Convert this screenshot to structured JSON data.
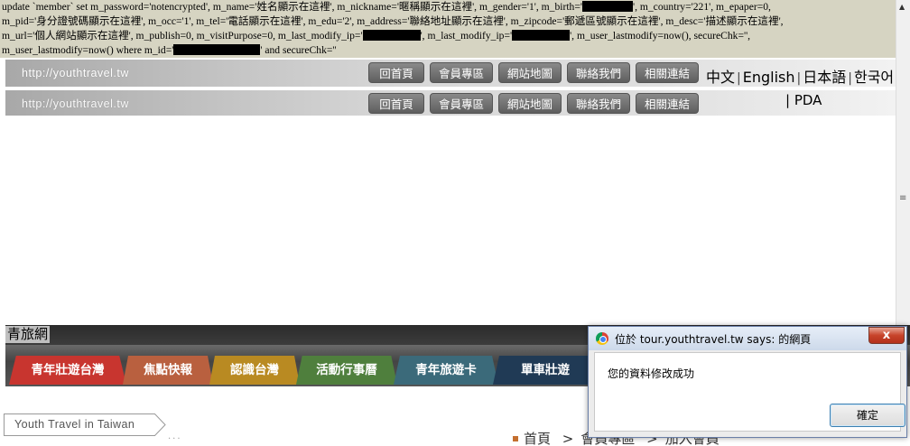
{
  "sql": {
    "line1_a": "update `member` set m_password='notencrypted', m_name='姓名顯示在這裡', m_nickname='暱稱顯示在這裡', m_gender='1', m_birth='",
    "line1_b": "', m_country='221', m_epaper=0,",
    "line2": "m_pid='身分證號碼顯示在這裡', m_occ='1', m_tel='電話顯示在這裡', m_edu='2', m_address='聯絡地址顯示在這裡', m_zipcode='郵遞區號顯示在這裡', m_desc='描述顯示在這裡',",
    "line3_a": "m_url='個人網站顯示在這裡', m_publish=0, m_visitPurpose=0, m_last_modify_ip='",
    "line3_b": "', m_last_modify_ip='",
    "line3_c": "', m_user_lastmodify=now(), secureChk='',",
    "line4_a": "m_user_lastmodify=now() where m_id='",
    "line4_b": "' and secureChk=''"
  },
  "header": {
    "site_url": "http://youthtravel.tw",
    "nav": [
      "回首頁",
      "會員專區",
      "網站地圖",
      "聯絡我們",
      "相關連結"
    ],
    "languages": [
      "中文",
      "English",
      "日本語",
      "한국어"
    ],
    "pda": "PDA"
  },
  "site_title": "青旅網",
  "tabs": [
    {
      "label": "青年壯遊台灣",
      "color": "#c8352f"
    },
    {
      "label": "焦點快報",
      "color": "#b9603f"
    },
    {
      "label": "認識台灣",
      "color": "#b98a22"
    },
    {
      "label": "活動行事曆",
      "color": "#4f7f3d"
    },
    {
      "label": "青年旅遊卡",
      "color": "#3b6a7a"
    },
    {
      "label": "單車壯遊",
      "color": "#203a55"
    }
  ],
  "sidebar": {
    "label": "Youth Travel in Taiwan"
  },
  "breadcrumb": {
    "home": "首頁",
    "sep": ">",
    "section": "會員專區",
    "page": "加入會員"
  },
  "dialog": {
    "title": "位於 tour.youthtravel.tw says: 的網頁",
    "message": "您的資料修改成功",
    "ok_label": "確定",
    "close_label": "x"
  }
}
